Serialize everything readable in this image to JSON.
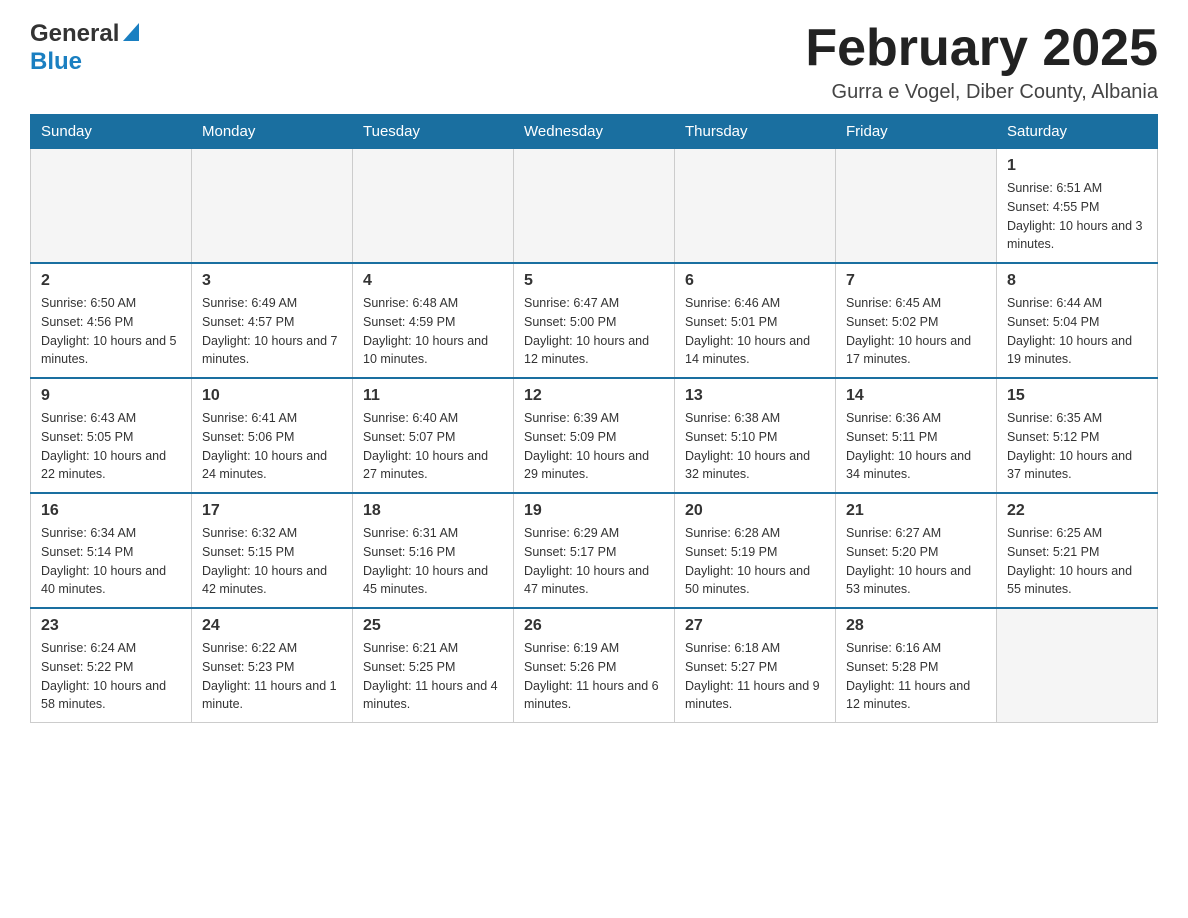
{
  "logo": {
    "general": "General",
    "blue": "Blue"
  },
  "title": {
    "month_year": "February 2025",
    "location": "Gurra e Vogel, Diber County, Albania"
  },
  "days_of_week": [
    "Sunday",
    "Monday",
    "Tuesday",
    "Wednesday",
    "Thursday",
    "Friday",
    "Saturday"
  ],
  "weeks": [
    [
      {
        "day": "",
        "info": ""
      },
      {
        "day": "",
        "info": ""
      },
      {
        "day": "",
        "info": ""
      },
      {
        "day": "",
        "info": ""
      },
      {
        "day": "",
        "info": ""
      },
      {
        "day": "",
        "info": ""
      },
      {
        "day": "1",
        "info": "Sunrise: 6:51 AM\nSunset: 4:55 PM\nDaylight: 10 hours and 3 minutes."
      }
    ],
    [
      {
        "day": "2",
        "info": "Sunrise: 6:50 AM\nSunset: 4:56 PM\nDaylight: 10 hours and 5 minutes."
      },
      {
        "day": "3",
        "info": "Sunrise: 6:49 AM\nSunset: 4:57 PM\nDaylight: 10 hours and 7 minutes."
      },
      {
        "day": "4",
        "info": "Sunrise: 6:48 AM\nSunset: 4:59 PM\nDaylight: 10 hours and 10 minutes."
      },
      {
        "day": "5",
        "info": "Sunrise: 6:47 AM\nSunset: 5:00 PM\nDaylight: 10 hours and 12 minutes."
      },
      {
        "day": "6",
        "info": "Sunrise: 6:46 AM\nSunset: 5:01 PM\nDaylight: 10 hours and 14 minutes."
      },
      {
        "day": "7",
        "info": "Sunrise: 6:45 AM\nSunset: 5:02 PM\nDaylight: 10 hours and 17 minutes."
      },
      {
        "day": "8",
        "info": "Sunrise: 6:44 AM\nSunset: 5:04 PM\nDaylight: 10 hours and 19 minutes."
      }
    ],
    [
      {
        "day": "9",
        "info": "Sunrise: 6:43 AM\nSunset: 5:05 PM\nDaylight: 10 hours and 22 minutes."
      },
      {
        "day": "10",
        "info": "Sunrise: 6:41 AM\nSunset: 5:06 PM\nDaylight: 10 hours and 24 minutes."
      },
      {
        "day": "11",
        "info": "Sunrise: 6:40 AM\nSunset: 5:07 PM\nDaylight: 10 hours and 27 minutes."
      },
      {
        "day": "12",
        "info": "Sunrise: 6:39 AM\nSunset: 5:09 PM\nDaylight: 10 hours and 29 minutes."
      },
      {
        "day": "13",
        "info": "Sunrise: 6:38 AM\nSunset: 5:10 PM\nDaylight: 10 hours and 32 minutes."
      },
      {
        "day": "14",
        "info": "Sunrise: 6:36 AM\nSunset: 5:11 PM\nDaylight: 10 hours and 34 minutes."
      },
      {
        "day": "15",
        "info": "Sunrise: 6:35 AM\nSunset: 5:12 PM\nDaylight: 10 hours and 37 minutes."
      }
    ],
    [
      {
        "day": "16",
        "info": "Sunrise: 6:34 AM\nSunset: 5:14 PM\nDaylight: 10 hours and 40 minutes."
      },
      {
        "day": "17",
        "info": "Sunrise: 6:32 AM\nSunset: 5:15 PM\nDaylight: 10 hours and 42 minutes."
      },
      {
        "day": "18",
        "info": "Sunrise: 6:31 AM\nSunset: 5:16 PM\nDaylight: 10 hours and 45 minutes."
      },
      {
        "day": "19",
        "info": "Sunrise: 6:29 AM\nSunset: 5:17 PM\nDaylight: 10 hours and 47 minutes."
      },
      {
        "day": "20",
        "info": "Sunrise: 6:28 AM\nSunset: 5:19 PM\nDaylight: 10 hours and 50 minutes."
      },
      {
        "day": "21",
        "info": "Sunrise: 6:27 AM\nSunset: 5:20 PM\nDaylight: 10 hours and 53 minutes."
      },
      {
        "day": "22",
        "info": "Sunrise: 6:25 AM\nSunset: 5:21 PM\nDaylight: 10 hours and 55 minutes."
      }
    ],
    [
      {
        "day": "23",
        "info": "Sunrise: 6:24 AM\nSunset: 5:22 PM\nDaylight: 10 hours and 58 minutes."
      },
      {
        "day": "24",
        "info": "Sunrise: 6:22 AM\nSunset: 5:23 PM\nDaylight: 11 hours and 1 minute."
      },
      {
        "day": "25",
        "info": "Sunrise: 6:21 AM\nSunset: 5:25 PM\nDaylight: 11 hours and 4 minutes."
      },
      {
        "day": "26",
        "info": "Sunrise: 6:19 AM\nSunset: 5:26 PM\nDaylight: 11 hours and 6 minutes."
      },
      {
        "day": "27",
        "info": "Sunrise: 6:18 AM\nSunset: 5:27 PM\nDaylight: 11 hours and 9 minutes."
      },
      {
        "day": "28",
        "info": "Sunrise: 6:16 AM\nSunset: 5:28 PM\nDaylight: 11 hours and 12 minutes."
      },
      {
        "day": "",
        "info": ""
      }
    ]
  ]
}
